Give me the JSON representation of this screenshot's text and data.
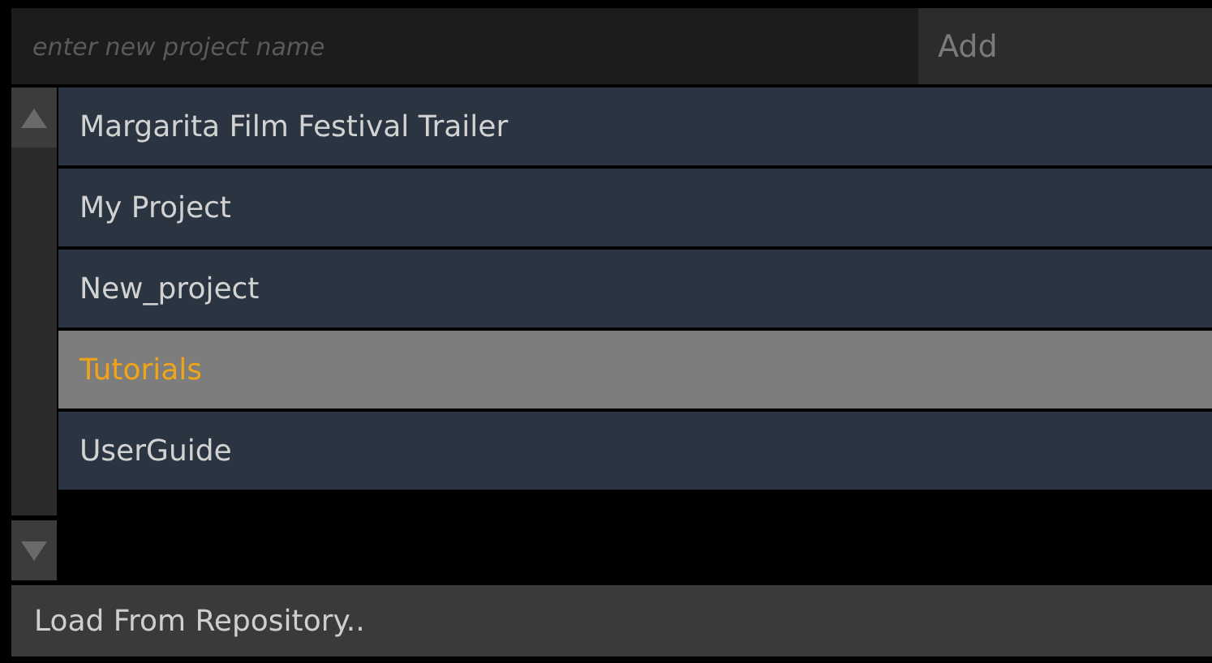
{
  "new_project": {
    "placeholder": "enter new project name",
    "add_button": "Add"
  },
  "projects": [
    {
      "name": "Margarita Film Festival Trailer",
      "selected": false
    },
    {
      "name": "My Project",
      "selected": false
    },
    {
      "name": "New_project",
      "selected": false
    },
    {
      "name": "Tutorials",
      "selected": true
    },
    {
      "name": "UserGuide",
      "selected": false
    }
  ],
  "footer_button": "Load From Repository.."
}
